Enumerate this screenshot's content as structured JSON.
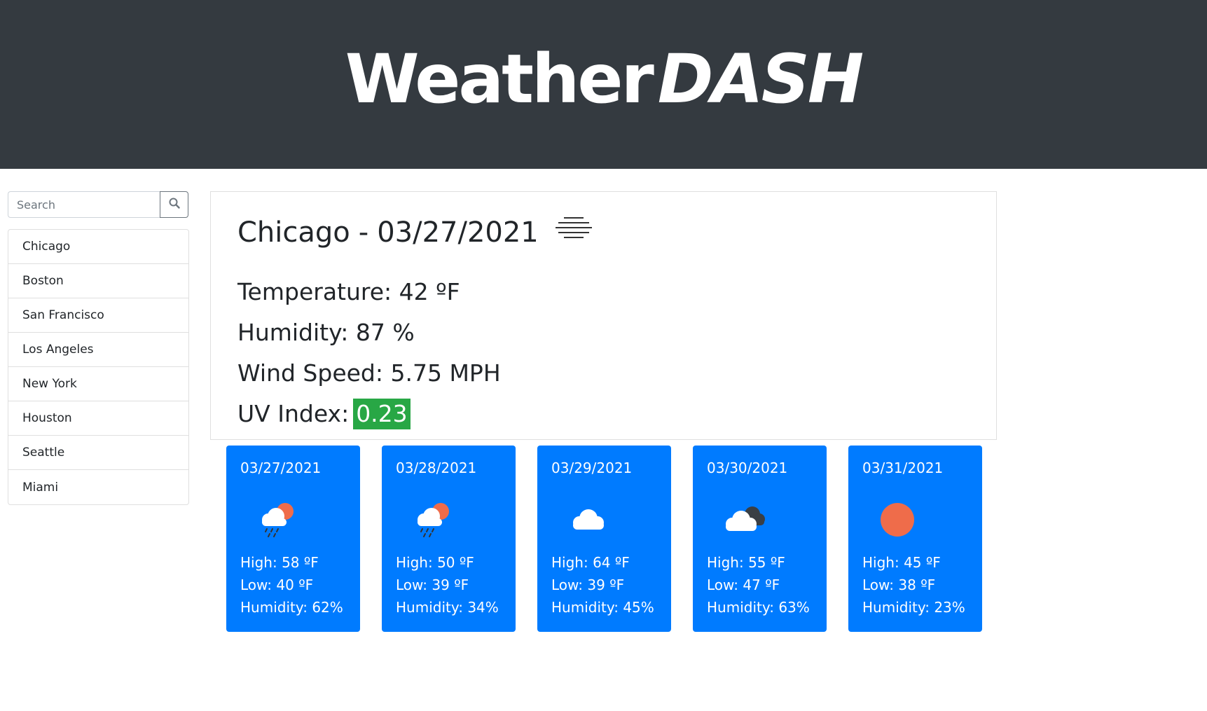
{
  "header": {
    "brand_part1": "Weather",
    "brand_part2": "DASH",
    "background_color": "#343a40"
  },
  "sidebar": {
    "search_placeholder": "Search",
    "search_icon": "search-icon",
    "cities": [
      "Chicago",
      "Boston",
      "San Francisco",
      "Los Angeles",
      "New York",
      "Houston",
      "Seattle",
      "Miami"
    ]
  },
  "current": {
    "city": "Chicago",
    "separator": "-",
    "date": "03/27/2021",
    "icon": "mist-icon",
    "temperature": "Temperature: 42 ºF",
    "humidity": "Humidity: 87 %",
    "wind": "Wind Speed: 5.75 MPH",
    "uv_label": "UV Index:",
    "uv_value": "0.23",
    "uv_color": "#28a745"
  },
  "forecast": [
    {
      "date": "03/27/2021",
      "icon": "sun-rain-icon",
      "high": "High: 58 ºF",
      "low": "Low: 40 ºF",
      "humidity": "Humidity: 62%"
    },
    {
      "date": "03/28/2021",
      "icon": "sun-rain-icon",
      "high": "High: 50 ºF",
      "low": "Low: 39 ºF",
      "humidity": "Humidity: 34%"
    },
    {
      "date": "03/29/2021",
      "icon": "cloud-icon",
      "high": "High: 64 ºF",
      "low": "Low: 39 ºF",
      "humidity": "Humidity: 45%"
    },
    {
      "date": "03/30/2021",
      "icon": "overcast-clouds-icon",
      "high": "High: 55 ºF",
      "low": "Low: 47 ºF",
      "humidity": "Humidity: 63%"
    },
    {
      "date": "03/31/2021",
      "icon": "sun-icon",
      "high": "High: 45 ºF",
      "low": "Low: 38 ºF",
      "humidity": "Humidity: 23%"
    }
  ],
  "colors": {
    "forecast_card": "#007bff",
    "sun": "#ef6c4a"
  }
}
